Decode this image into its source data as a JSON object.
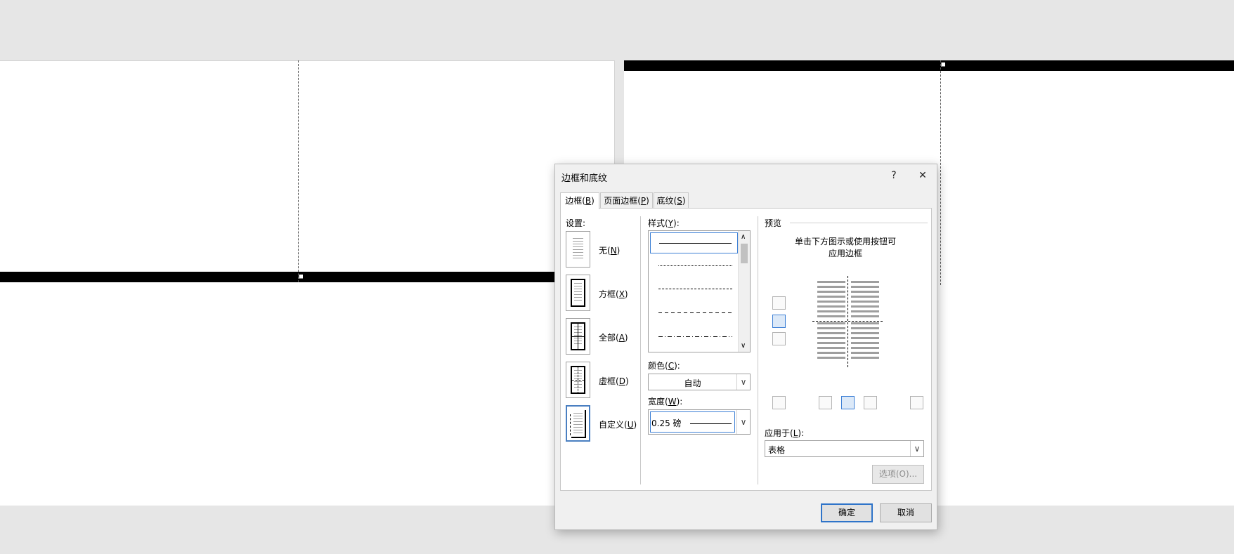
{
  "dialog": {
    "title": "边框和底纹",
    "help_glyph": "?",
    "close_glyph": "✕",
    "tabs": [
      {
        "label": "边框(",
        "key": "B",
        "tail": ")"
      },
      {
        "label": "页面边框(",
        "key": "P",
        "tail": ")"
      },
      {
        "label": "底纹(",
        "key": "S",
        "tail": ")"
      }
    ],
    "settings": {
      "heading": "设置:",
      "items": [
        {
          "label": "无(",
          "key": "N",
          "tail": ")"
        },
        {
          "label": "方框(",
          "key": "X",
          "tail": ")"
        },
        {
          "label": "全部(",
          "key": "A",
          "tail": ")"
        },
        {
          "label": "虚框(",
          "key": "D",
          "tail": ")"
        },
        {
          "label": "自定义(",
          "key": "U",
          "tail": ")"
        }
      ],
      "selected": "自定义"
    },
    "style": {
      "heading": "样式(",
      "key": "Y",
      "tail": "):",
      "items": [
        "solid",
        "dotted",
        "dense-dash",
        "dash",
        "dash-dot"
      ],
      "selected": "solid"
    },
    "color": {
      "heading": "颜色(",
      "key": "C",
      "tail": "):",
      "value": "自动"
    },
    "width": {
      "heading": "宽度(",
      "key": "W",
      "tail": "):",
      "value": "0.25 磅"
    },
    "preview": {
      "heading": "预览",
      "hint_line1": "单击下方图示或使用按钮可",
      "hint_line2": "应用边框"
    },
    "apply_to": {
      "heading": "应用于(",
      "key": "L",
      "tail": "):",
      "value": "表格"
    },
    "options_button": "选项(O)...",
    "ok_button": "确定",
    "cancel_button": "取消"
  },
  "colors": {
    "accent": "#2f74c9",
    "dialog_bg": "#f0f0f0",
    "app_bg": "#e6e6e6"
  }
}
